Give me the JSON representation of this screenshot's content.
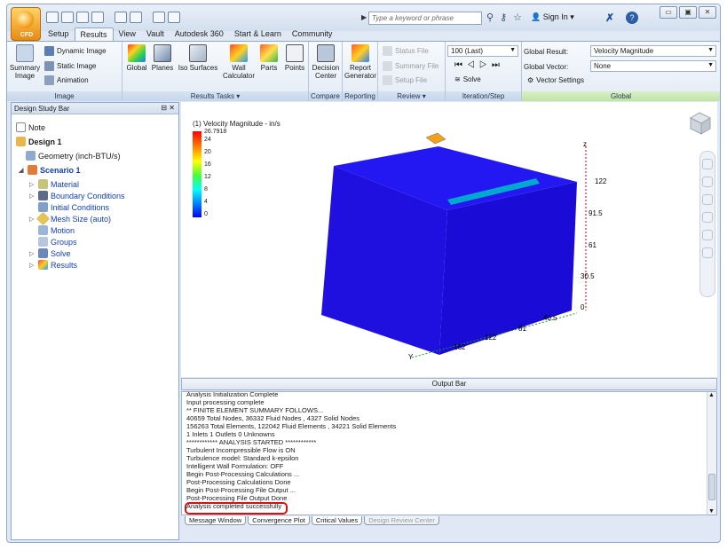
{
  "app": {
    "logo_text": "CFD"
  },
  "titlebar": {
    "search_placeholder": "Type a keyword or phrase",
    "sign_in": "Sign In",
    "help": "?",
    "min": "▭",
    "restore": "▣",
    "close": "✕"
  },
  "tabs": [
    {
      "label": "Setup"
    },
    {
      "label": "Results",
      "active": true
    },
    {
      "label": "View"
    },
    {
      "label": "Vault"
    },
    {
      "label": "Autodesk 360"
    },
    {
      "label": "Start & Learn"
    },
    {
      "label": "Community"
    }
  ],
  "ribbon": {
    "image": {
      "label": "Image",
      "summary_image": "Summary\nImage",
      "dynamic_image": "Dynamic Image",
      "static_image": "Static Image",
      "animation": "Animation"
    },
    "results_tasks": {
      "label": "Results Tasks ▾",
      "global": "Global",
      "planes": "Planes",
      "iso_surfaces": "Iso Surfaces",
      "wall_calculator": "Wall\nCalculator",
      "parts": "Parts",
      "points": "Points"
    },
    "compare": {
      "label": "Compare",
      "decision_center": "Decision\nCenter"
    },
    "reporting": {
      "label": "Reporting",
      "report_generator": "Report\nGenerator"
    },
    "review": {
      "label": "Review ▾",
      "status_file": "Status File",
      "summary_file": "Summary File",
      "setup_file": "Setup File"
    },
    "iteration": {
      "label": "Iteration/Step",
      "step_value": "100 (Last)",
      "solve": "Solve"
    },
    "global": {
      "label": "Global",
      "result_label": "Global Result:",
      "result_value": "Velocity Magnitude",
      "vector_label": "Global Vector:",
      "vector_value": "None",
      "vector_settings": "Vector Settings"
    }
  },
  "design_study_bar": {
    "title": "Design Study Bar",
    "note": "Note",
    "design": "Design 1",
    "geometry": "Geometry (inch-BTU/s)",
    "scenario": "Scenario 1",
    "items": [
      {
        "label": "Material"
      },
      {
        "label": "Boundary Conditions"
      },
      {
        "label": "Initial Conditions"
      },
      {
        "label": "Mesh Size (auto)"
      },
      {
        "label": "Motion"
      },
      {
        "label": "Groups"
      },
      {
        "label": "Solve"
      },
      {
        "label": "Results"
      }
    ]
  },
  "viewport": {
    "legend_title": "(1) Velocity Magnitude - in/s",
    "legend_values": [
      "26.7918",
      "24",
      "20",
      "16",
      "12",
      "8",
      "4",
      "0"
    ],
    "z_ticks": [
      "122",
      "91.5",
      "61",
      "30.5",
      "0"
    ],
    "x_ticks": [
      "40.5",
      "81",
      "122",
      "162"
    ],
    "axis_z": "z",
    "axis_y": "Y",
    "colors": {
      "model": "#1a10e8",
      "max": "#ff0000",
      "min": "#0000ff"
    }
  },
  "output": {
    "bar_label": "Output Bar",
    "lines": [
      "Analysis Initialization Complete",
      "Input processing complete",
      "** FINITE ELEMENT SUMMARY FOLLOWS...",
      "40659 Total Nodes,   36332 Fluid Nodes ,   4327 Solid Nodes",
      "156263 Total Elements,   122042 Fluid Elements ,   34221 Solid Elements",
      "1 Inlets    1 Outlets    0 Unknowns",
      "************ ANALYSIS STARTED ************",
      "Turbulent Incompressible Flow is ON",
      "Turbulence model: Standard k-epsilon",
      "Intelligent Wall Formulation: OFF",
      "Begin Post-Processing Calculations ...",
      "Post-Processing Calculations Done",
      "Begin Post-Processing File Output ...",
      "Post-Processing File Output Done",
      "Analysis completed successfully"
    ],
    "tabs": [
      "Message Window",
      "Convergence Plot",
      "Critical Values",
      "Design Review Center"
    ]
  }
}
